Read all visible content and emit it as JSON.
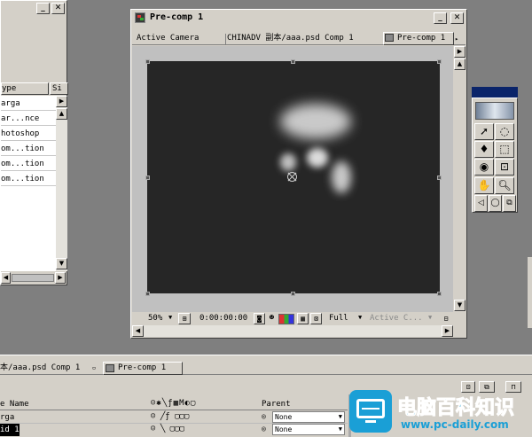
{
  "project_panel": {
    "col_type": "ype",
    "col_size": "Si",
    "items": [
      "arga",
      "ar...nce",
      "hotoshop",
      "om...tion",
      "om...tion",
      "om...tion"
    ]
  },
  "comp_window": {
    "title": "Pre-comp 1",
    "tabs": [
      "Active Camera",
      "CHINADV 副本/aaa.psd Comp 1",
      "Pre-comp 1"
    ],
    "bg_color": "#262626",
    "footer": {
      "zoom": "50%",
      "timecode": "0:00:00:00",
      "resolution": "Full",
      "camera": "Active C..."
    }
  },
  "tools_panel": {
    "tool_icons": [
      "selection-icon",
      "rotate-icon",
      "pen-icon",
      "mask-icon",
      "pan-behind-icon",
      "zoom-icon",
      "hand-icon",
      "magnify-icon",
      "camera-icon",
      "orbit-icon",
      "track-icon"
    ]
  },
  "timeline": {
    "tabs": [
      "本/aaa.psd Comp 1",
      "Pre-comp 1"
    ],
    "header": {
      "layer_name": "e Name",
      "parent": "Parent"
    },
    "layers": [
      {
        "name": "rga",
        "parent": "None"
      },
      {
        "name": "id 1",
        "parent": "None"
      }
    ]
  },
  "watermark": {
    "title": "电脑百科知识",
    "url": "www.pc-daily.com"
  }
}
